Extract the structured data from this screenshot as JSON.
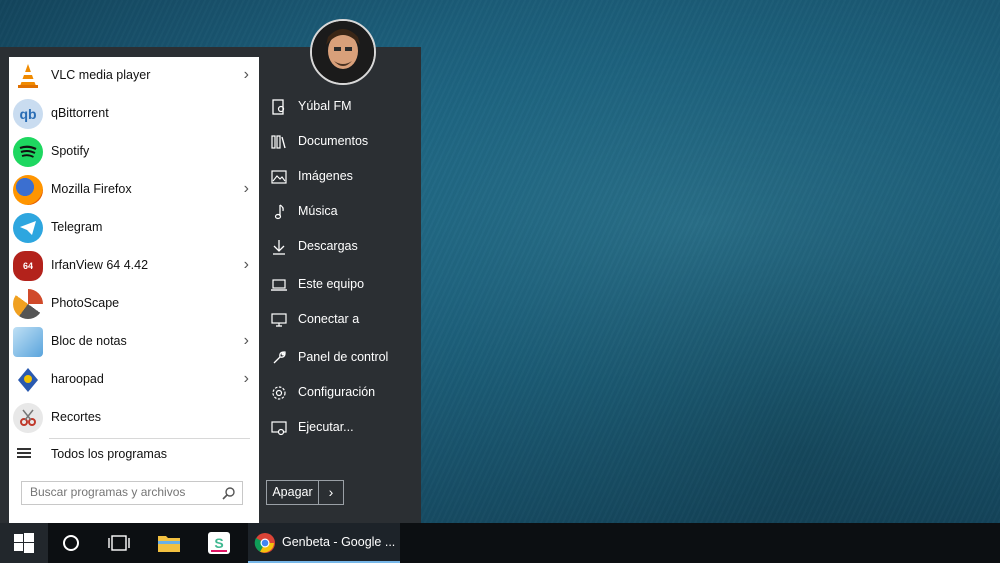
{
  "start_menu": {
    "programs": [
      {
        "label": "VLC media player",
        "icon": "vlc-icon",
        "has_submenu": true,
        "color": "#f08a00"
      },
      {
        "label": "qBittorrent",
        "icon": "qbittorrent-icon",
        "has_submenu": false,
        "color": "#3a7fc2"
      },
      {
        "label": "Spotify",
        "icon": "spotify-icon",
        "has_submenu": false,
        "color": "#1ed760"
      },
      {
        "label": "Mozilla Firefox",
        "icon": "firefox-icon",
        "has_submenu": true,
        "color": "#e66000"
      },
      {
        "label": "Telegram",
        "icon": "telegram-icon",
        "has_submenu": false,
        "color": "#2ea6df"
      },
      {
        "label": "IrfanView 64 4.42",
        "icon": "irfanview-icon",
        "has_submenu": true,
        "color": "#b3221b"
      },
      {
        "label": "PhotoScape",
        "icon": "photoscape-icon",
        "has_submenu": false,
        "color": "#d04a2a"
      },
      {
        "label": "Bloc de notas",
        "icon": "notepad-icon",
        "has_submenu": true,
        "color": "#5aa4dc"
      },
      {
        "label": "haroopad",
        "icon": "haroopad-icon",
        "has_submenu": true,
        "color": "#2a5ab0"
      },
      {
        "label": "Recortes",
        "icon": "snipping-tool-icon",
        "has_submenu": false,
        "color": "#c0392b"
      }
    ],
    "all_programs_label": "Todos los programas",
    "search_placeholder": "Buscar programas y archivos",
    "places": [
      {
        "label": "Yúbal FM",
        "icon": "user-folder-icon"
      },
      {
        "label": "Documentos",
        "icon": "documents-icon"
      },
      {
        "label": "Imágenes",
        "icon": "pictures-icon"
      },
      {
        "label": "Música",
        "icon": "music-icon"
      },
      {
        "label": "Descargas",
        "icon": "downloads-icon"
      },
      {
        "label": "Este equipo",
        "icon": "computer-icon"
      },
      {
        "label": "Conectar a",
        "icon": "connect-icon"
      },
      {
        "label": "Panel de control",
        "icon": "control-panel-icon"
      },
      {
        "label": "Configuración",
        "icon": "settings-gear-icon"
      },
      {
        "label": "Ejecutar...",
        "icon": "run-icon"
      }
    ],
    "power_label": "Apagar"
  },
  "taskbar": {
    "chrome_label": "Genbeta - Google ...",
    "items": [
      "windows-start-icon",
      "cortana-icon",
      "task-view-icon",
      "file-explorer-icon",
      "slack-icon",
      "chrome-icon"
    ]
  }
}
